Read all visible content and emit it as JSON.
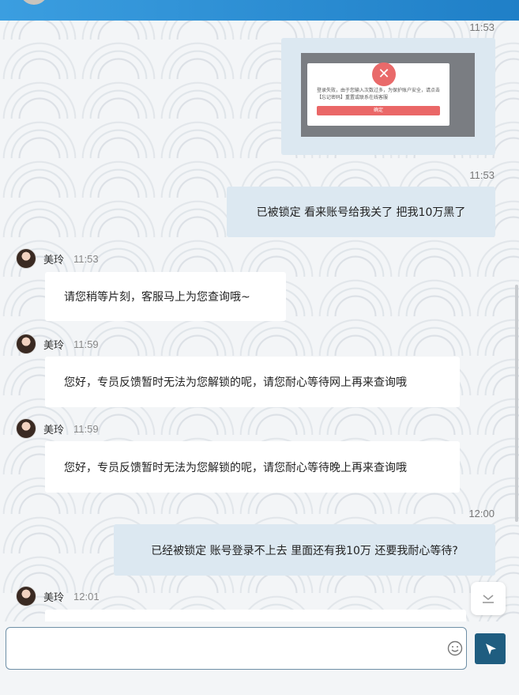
{
  "chat": {
    "messages": [
      {
        "type": "outgoing-image",
        "time": "11:53",
        "image": {
          "dialog_text": "登录失败，由于您输入次数过多，为保护账户安全，请点击【忘记密码】重置或联系在线客服",
          "button": "确定"
        }
      },
      {
        "type": "outgoing",
        "time": "11:53",
        "text": "已被锁定 看来账号给我关了 把我10万黑了"
      },
      {
        "type": "incoming",
        "sender": "美玲",
        "time": "11:53",
        "text": "请您稍等片刻，客服马上为您查询哦~"
      },
      {
        "type": "incoming",
        "sender": "美玲",
        "time": "11:59",
        "text": "您好，专员反馈暂时无法为您解锁的呢，请您耐心等待网上再来查询哦"
      },
      {
        "type": "incoming",
        "sender": "美玲",
        "time": "11:59",
        "text": "您好，专员反馈暂时无法为您解锁的呢，请您耐心等待晚上再来查询哦"
      },
      {
        "type": "outgoing",
        "time": "12:00",
        "text": "已经被锁定 账号登录不上去 里面还有我10万 还要我耐心等待?"
      },
      {
        "type": "incoming",
        "sender": "美玲",
        "time": "12:01",
        "text": ""
      }
    ]
  },
  "composer": {
    "placeholder": "",
    "emoji_icon": "smiley-icon",
    "send_icon": "send-icon"
  },
  "colors": {
    "header": "#2a8fd6",
    "outgoing_bubble": "#dce8f1",
    "incoming_bubble": "#ffffff",
    "send_button": "#1f5d80"
  }
}
